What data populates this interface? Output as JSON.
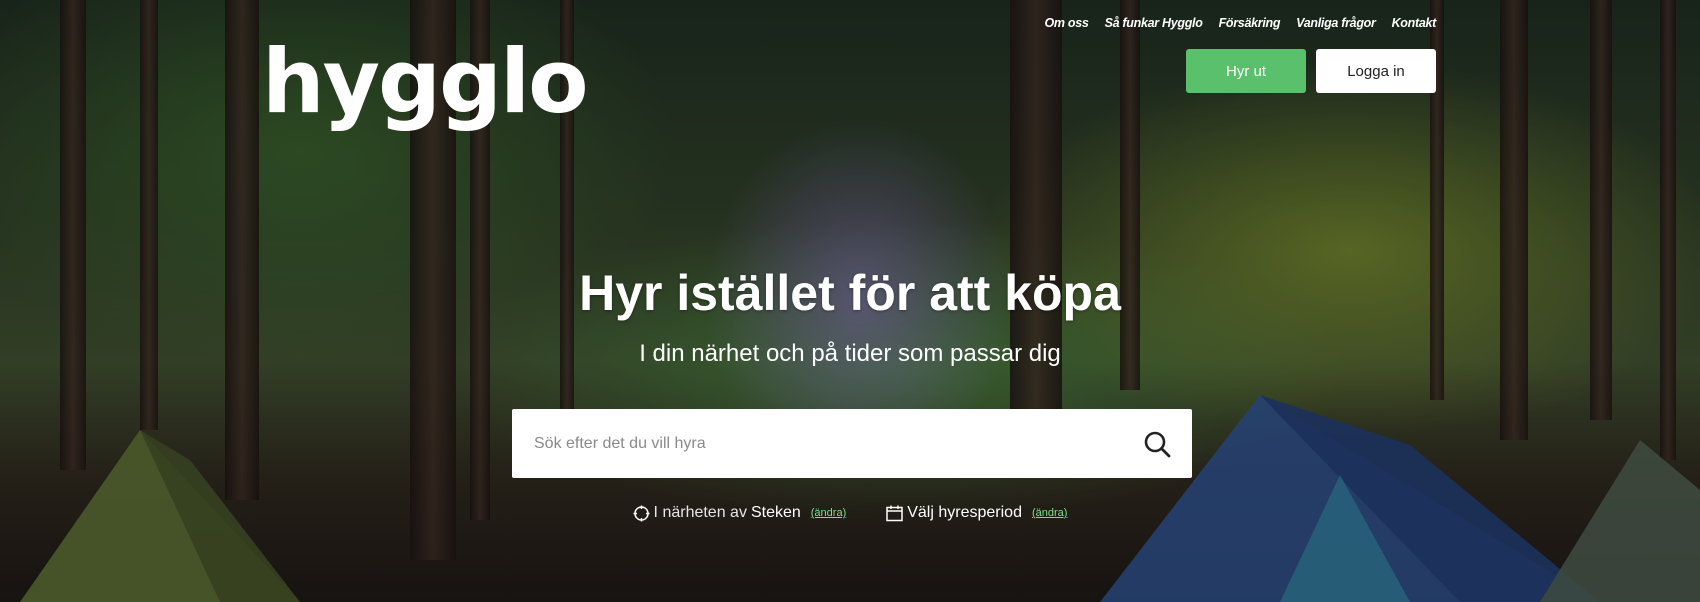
{
  "brand": {
    "logo_text": "hygglo"
  },
  "topnav": {
    "items": [
      {
        "label": "Om oss"
      },
      {
        "label": "Så funkar Hygglo"
      },
      {
        "label": "Försäkring"
      },
      {
        "label": "Vanliga frågor"
      },
      {
        "label": "Kontakt"
      }
    ]
  },
  "header_buttons": {
    "rent_out": "Hyr ut",
    "login": "Logga in"
  },
  "hero": {
    "headline": "Hyr istället för att köpa",
    "subheadline": "I din närhet och på tider som passar dig"
  },
  "search": {
    "placeholder": "Sök efter det du vill hyra",
    "value": "",
    "icon": "search-icon"
  },
  "filters": {
    "location": {
      "icon": "location-target-icon",
      "prefix": "I närheten av",
      "place": "Steken",
      "change_label": "(ändra)"
    },
    "period": {
      "icon": "calendar-icon",
      "label": "Välj hyresperiod",
      "change_label": "(ändra)"
    }
  },
  "colors": {
    "accent_green": "#5ac06b",
    "link_green": "#7be08a",
    "white": "#ffffff"
  }
}
